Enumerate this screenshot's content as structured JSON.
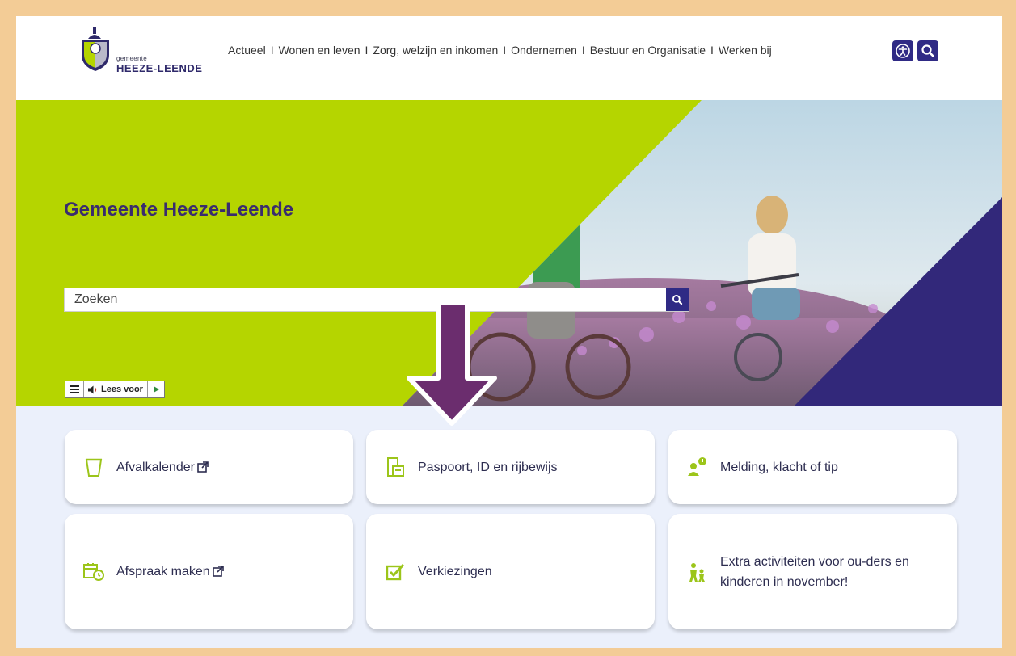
{
  "logo": {
    "small": "gemeente",
    "big": "HEEZE-LEENDE"
  },
  "nav": [
    "Actueel",
    "Wonen en leven",
    "Zorg, welzijn en inkomen",
    "Ondernemen",
    "Bestuur en Organisatie",
    "Werken bij"
  ],
  "nav_separator": "I",
  "header_icons": {
    "accessibility": "accessibility-icon",
    "search": "search-icon"
  },
  "hero": {
    "title": "Gemeente Heeze-Leende",
    "search_placeholder": "Zoeken"
  },
  "readspeaker": {
    "label": "Lees voor"
  },
  "tiles": [
    {
      "label": "Afvalkalender",
      "icon": "waste-bin-icon",
      "external": true
    },
    {
      "label": "Paspoort, ID en rijbewijs",
      "icon": "id-card-icon",
      "external": false
    },
    {
      "label": "Melding, klacht of tip",
      "icon": "report-person-icon",
      "external": false
    },
    {
      "label": "Afspraak maken",
      "icon": "calendar-clock-icon",
      "external": true
    },
    {
      "label": "Verkiezingen",
      "icon": "checkbox-icon",
      "external": false
    },
    {
      "label": "Extra activiteiten voor ou-ders en kinderen in november!",
      "icon": "family-icon",
      "external": false
    }
  ],
  "colors": {
    "page_border": "#F3CC96",
    "hero_green": "#B5D500",
    "brand_purple": "#2f2a85",
    "title_purple": "#3a2c6e",
    "arrow_purple": "#6B2D6E",
    "tile_background": "#EBF0FB",
    "icon_green": "#9CC51A"
  }
}
